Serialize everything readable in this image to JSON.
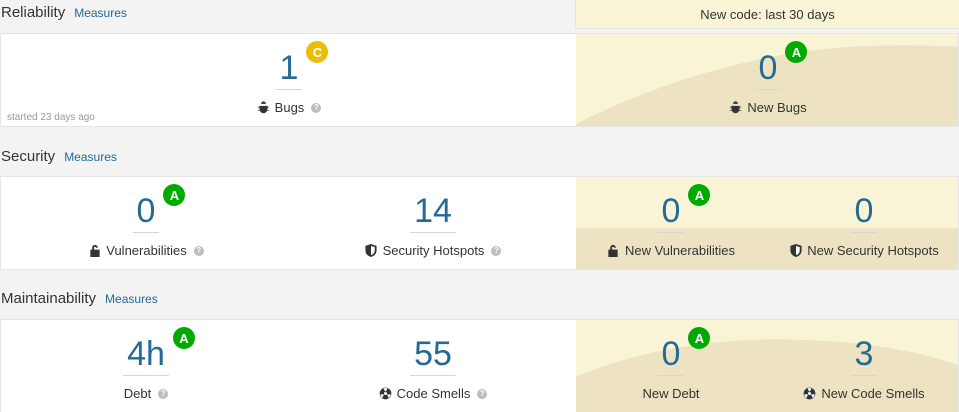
{
  "newcode": {
    "label": "New code: last 30 days"
  },
  "reliability": {
    "title": "Reliability",
    "measures": "Measures",
    "bugs": {
      "value": "1",
      "rating": "C",
      "label": "Bugs"
    },
    "started": "started 23 days ago",
    "new_bugs": {
      "value": "0",
      "rating": "A",
      "label": "New Bugs"
    }
  },
  "security": {
    "title": "Security",
    "measures": "Measures",
    "vulnerabilities": {
      "value": "0",
      "rating": "A",
      "label": "Vulnerabilities"
    },
    "hotspots": {
      "value": "14",
      "label": "Security Hotspots"
    },
    "new_vulnerabilities": {
      "value": "0",
      "rating": "A",
      "label": "New Vulnerabilities"
    },
    "new_hotspots": {
      "value": "0",
      "label": "New Security Hotspots"
    }
  },
  "maintainability": {
    "title": "Maintainability",
    "measures": "Measures",
    "debt": {
      "value": "4h",
      "rating": "A",
      "label": "Debt"
    },
    "code_smells": {
      "value": "55",
      "label": "Code Smells"
    },
    "new_debt": {
      "value": "0",
      "rating": "A",
      "label": "New Debt"
    },
    "new_code_smells": {
      "value": "3",
      "label": "New Code Smells"
    }
  },
  "help_glyph": "?",
  "colors": {
    "value_blue": "#236a97",
    "rating_a": "#00aa00",
    "rating_c": "#eabe06",
    "newcode_bg": "#faf4d6",
    "wave": "#ede3c3"
  },
  "icons": {
    "bug": "bug-icon",
    "lock": "lock-icon",
    "shield": "shield-icon",
    "smell": "code-smell-icon"
  }
}
